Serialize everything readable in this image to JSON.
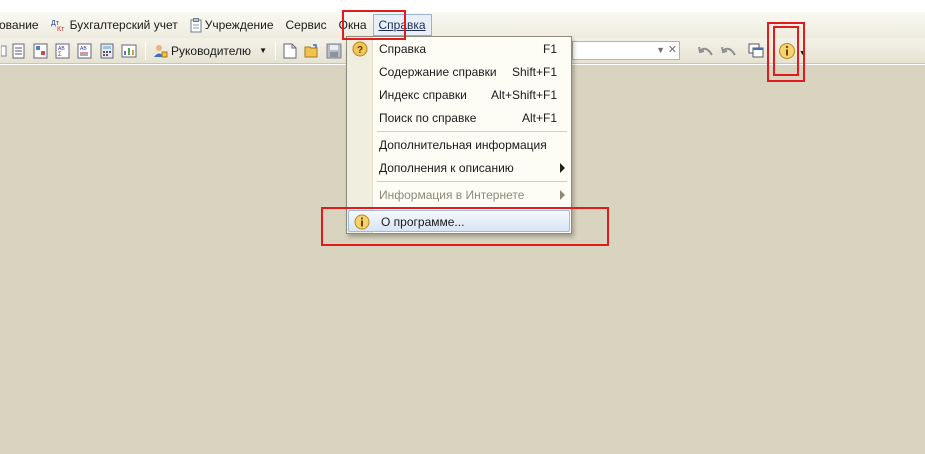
{
  "menubar": {
    "items": [
      {
        "label": "ование",
        "has_icon": false
      },
      {
        "label": "Бухгалтерский учет",
        "icon": "debit-credit-icon"
      },
      {
        "label": "Учреждение",
        "icon": "clipboard-icon"
      },
      {
        "label": "Сервис"
      },
      {
        "label": "Окна"
      },
      {
        "label": "Справка",
        "active": true
      }
    ]
  },
  "toolbar": {
    "manager_label": "Руководителю",
    "search_value": ""
  },
  "help_menu": {
    "items": [
      {
        "label": "Справка",
        "shortcut": "F1",
        "icon": "question-icon"
      },
      {
        "label": "Содержание справки",
        "shortcut": "Shift+F1"
      },
      {
        "label": "Индекс справки",
        "shortcut": "Alt+Shift+F1"
      },
      {
        "label": "Поиск по справке",
        "shortcut": "Alt+F1"
      },
      {
        "label": "Дополнительная информация"
      },
      {
        "label": "Дополнения к описанию",
        "submenu": true
      },
      {
        "label": "Информация в Интернете",
        "submenu": true,
        "disabled": true
      },
      {
        "label": "О программе...",
        "icon": "info-icon",
        "highlighted": true
      }
    ]
  },
  "colors": {
    "workspace": "#d8d4bf",
    "annotation_red": "#e01c1c",
    "highlight_blue": "#d7e4f5"
  }
}
